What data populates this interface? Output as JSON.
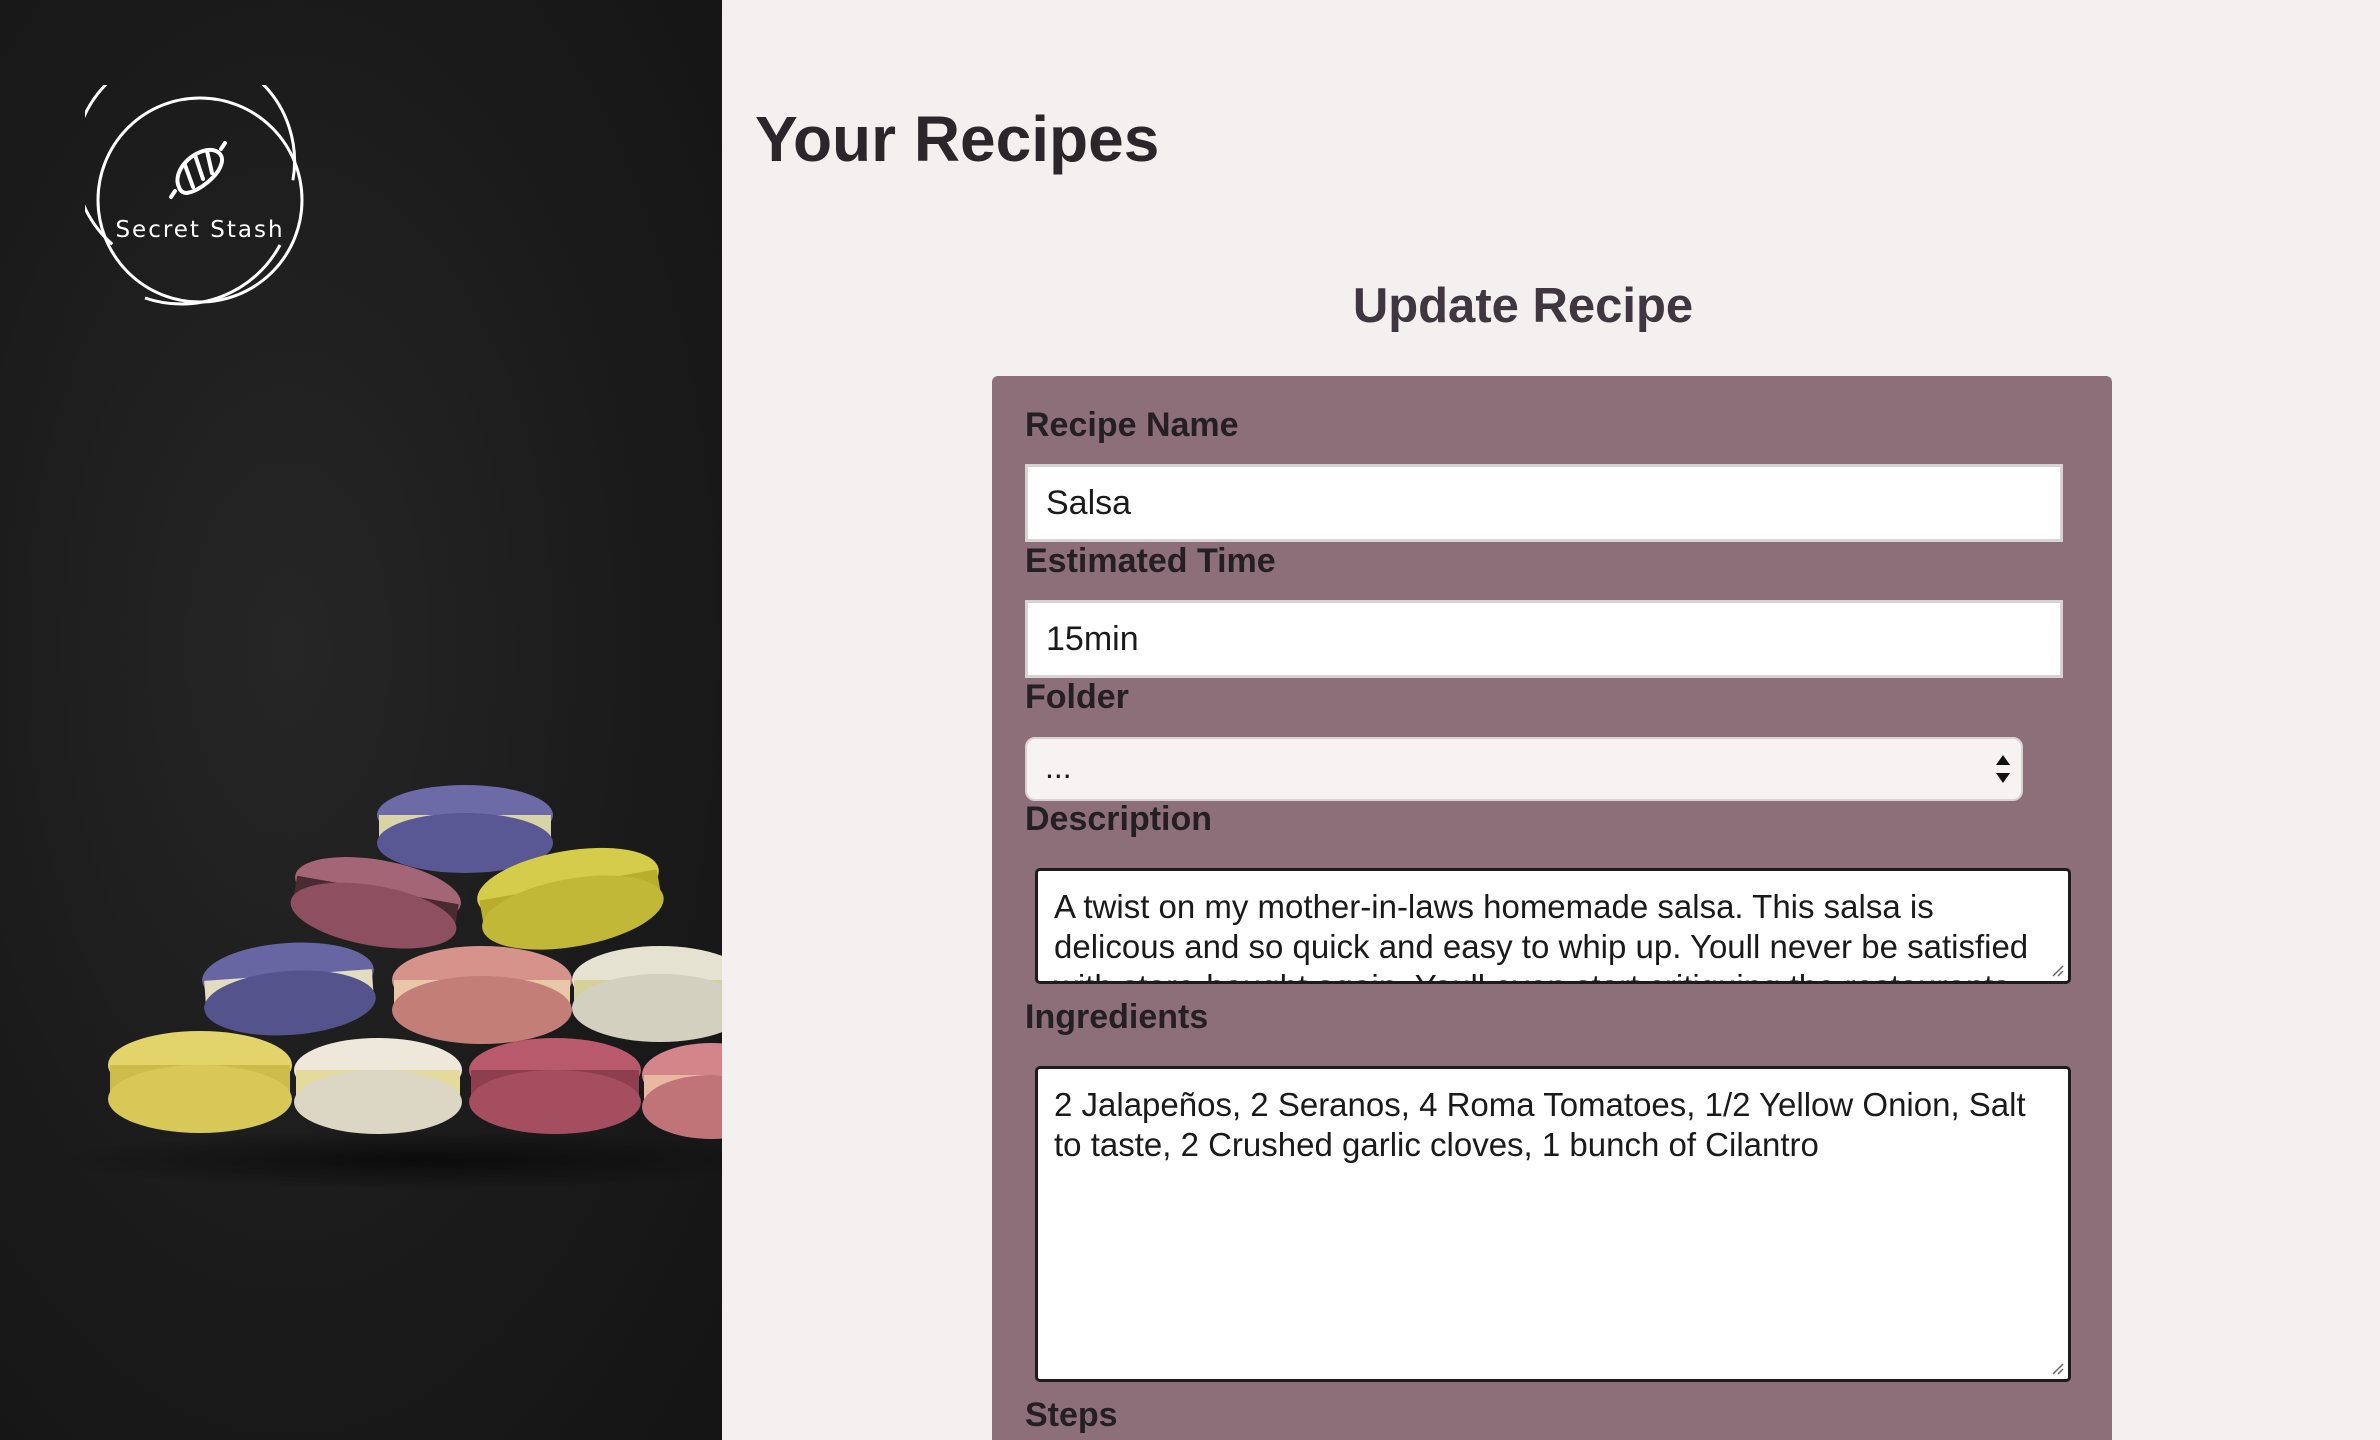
{
  "sidebar": {
    "logo_text": "Secret Stash",
    "logo_icon": "croissant-icon"
  },
  "main": {
    "page_title": "Your Recipes",
    "form_title": "Update Recipe",
    "fields": {
      "recipe_name": {
        "label": "Recipe Name",
        "value": "Salsa"
      },
      "estimated_time": {
        "label": "Estimated Time",
        "value": "15min"
      },
      "folder": {
        "label": "Folder",
        "value": "..."
      },
      "description": {
        "label": "Description",
        "value": "A twist on my mother-in-laws homemade salsa. This salsa is delicous and so quick and easy to whip up. Youll never be satisfied with store-bought again. Youll even start critiquing the restaurants"
      },
      "ingredients": {
        "label": "Ingredients",
        "value": "2 Jalapeños, 2 Seranos, 4 Roma Tomatoes, 1/2 Yellow Onion, Salt to taste, 2 Crushed garlic cloves, 1 bunch of Cilantro"
      },
      "steps": {
        "label": "Steps"
      }
    }
  },
  "colors": {
    "sidebar_bg": "#1b1b1b",
    "page_bg": "#f4f0ef",
    "form_bg": "#8d6f79",
    "title_text": "#2b2629"
  }
}
